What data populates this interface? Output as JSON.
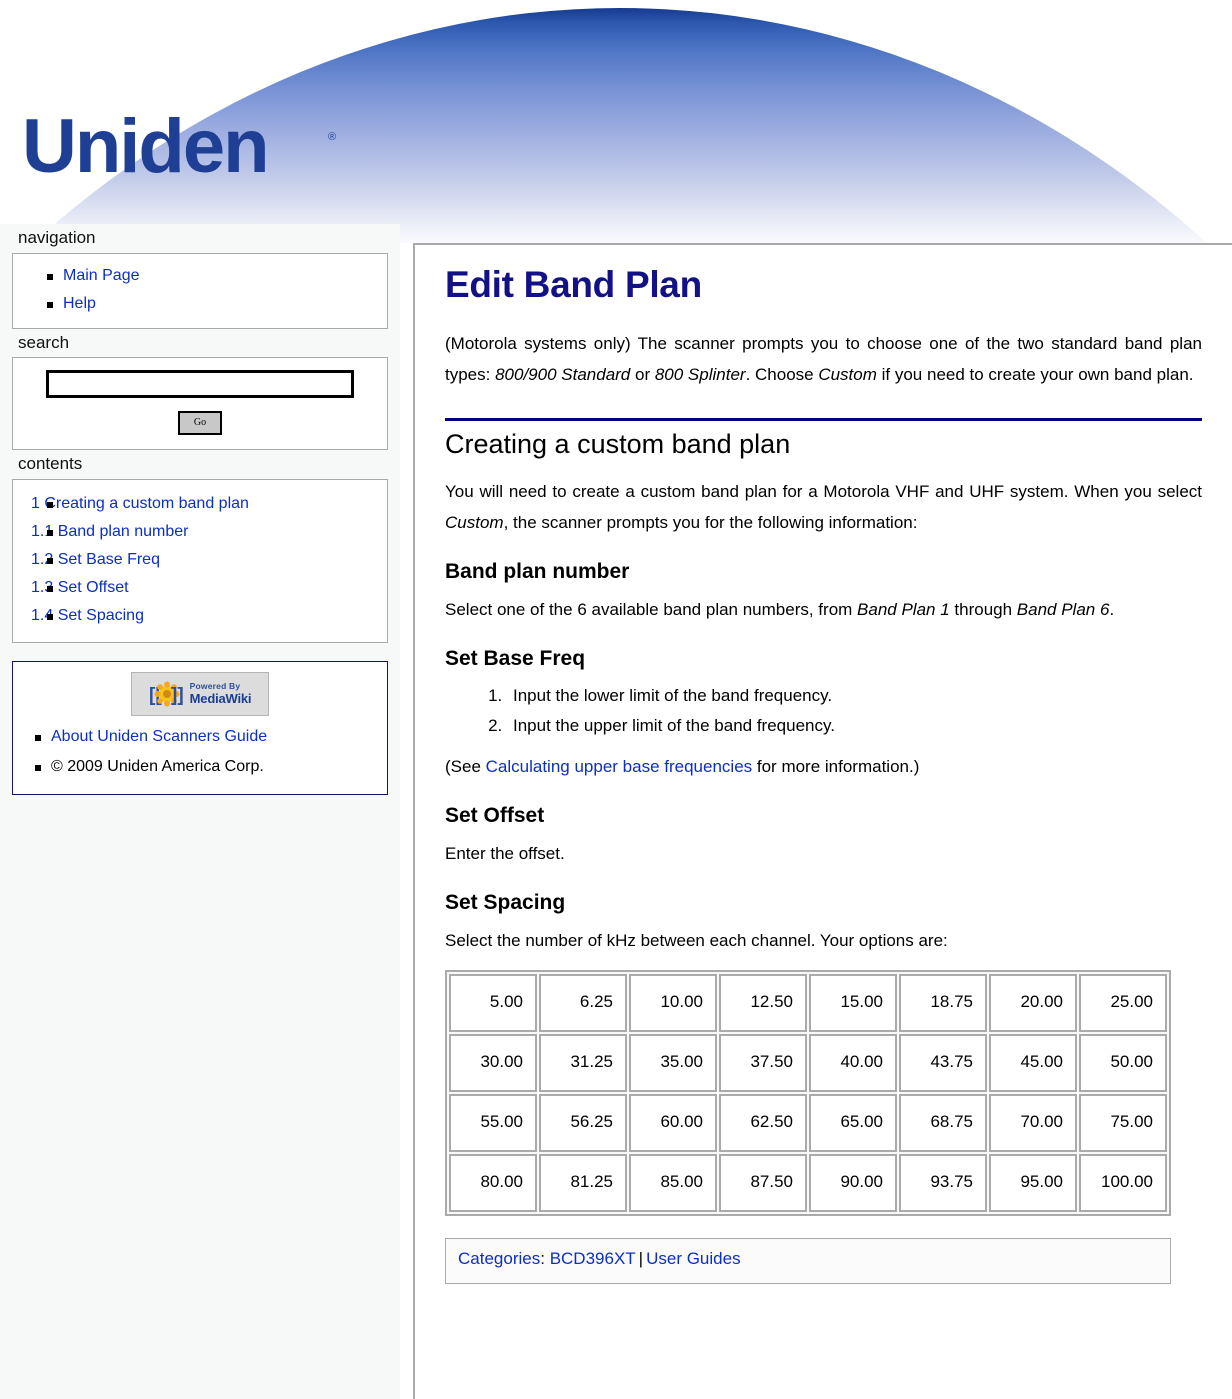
{
  "site": {
    "logo_text": "Uniden",
    "logo_registered_mark": "®"
  },
  "sidebar": {
    "navigation": {
      "title": "navigation",
      "items": [
        {
          "label": "Main Page"
        },
        {
          "label": "Help"
        }
      ]
    },
    "search": {
      "title": "search",
      "value": "",
      "placeholder": "",
      "go_label": "Go"
    },
    "contents": {
      "title": "contents",
      "items": [
        {
          "label": "1 Creating a custom band plan"
        },
        {
          "label": "1.1 Band plan number"
        },
        {
          "label": "1.2 Set Base Freq"
        },
        {
          "label": "1.3 Set Offset"
        },
        {
          "label": "1.4 Set Spacing"
        }
      ]
    },
    "footer_box": {
      "badge": {
        "powered_by": "Powered By",
        "name": "MediaWiki"
      },
      "items": [
        {
          "label": "About Uniden Scanners Guide",
          "link": true
        },
        {
          "label": "© 2009 Uniden America Corp.",
          "link": false
        }
      ]
    }
  },
  "content": {
    "title": "Edit Band Plan",
    "intro": {
      "part1": "(Motorola systems only) The scanner prompts you to choose one of the two standard band plan types: ",
      "em1": "800/900 Standard",
      "part2": " or ",
      "em2": "800 Splinter",
      "part3": ". Choose ",
      "em3": "Custom",
      "part4": " if you need to create your own band plan."
    },
    "section1": {
      "heading": "Creating a custom band plan",
      "para": {
        "part1": "You will need to create a custom band plan for a Motorola VHF and UHF system. When you select ",
        "em1": "Custom",
        "part2": ", the scanner prompts you for the following information:"
      }
    },
    "band_plan_number": {
      "heading": "Band plan number",
      "para": {
        "part1": "Select one of the 6 available band plan numbers, from ",
        "em1": "Band Plan 1",
        "part2": " through ",
        "em2": "Band Plan 6",
        "part3": "."
      }
    },
    "set_base_freq": {
      "heading": "Set Base Freq",
      "steps": [
        "Input the lower limit of the band frequency.",
        "Input the upper limit of the band frequency."
      ],
      "see_note": {
        "part1": "(See ",
        "link": "Calculating upper base frequencies",
        "part2": " for more information.)"
      }
    },
    "set_offset": {
      "heading": "Set Offset",
      "para": "Enter the offset."
    },
    "set_spacing": {
      "heading": "Set Spacing",
      "para": "Select the number of kHz between each channel. Your options are:",
      "table": {
        "rows": [
          [
            "5.00",
            "6.25",
            "10.00",
            "12.50",
            "15.00",
            "18.75",
            "20.00",
            "25.00"
          ],
          [
            "30.00",
            "31.25",
            "35.00",
            "37.50",
            "40.00",
            "43.75",
            "45.00",
            "50.00"
          ],
          [
            "55.00",
            "56.25",
            "60.00",
            "62.50",
            "65.00",
            "68.75",
            "70.00",
            "75.00"
          ],
          [
            "80.00",
            "81.25",
            "85.00",
            "87.50",
            "90.00",
            "93.75",
            "95.00",
            "100.00"
          ]
        ]
      }
    },
    "categories": {
      "label": "Categories",
      "colon": ":",
      "items": [
        {
          "label": "BCD396XT"
        },
        {
          "label": "User Guides"
        }
      ],
      "separator": "|"
    }
  },
  "colors": {
    "banner_blue_dark": "#163a8f",
    "logo_blue": "#1a3a8f",
    "link_blue": "#0b2fc4",
    "title_navy": "#121286",
    "rule_navy": "#000080",
    "table_border": "#aaaaaa"
  }
}
